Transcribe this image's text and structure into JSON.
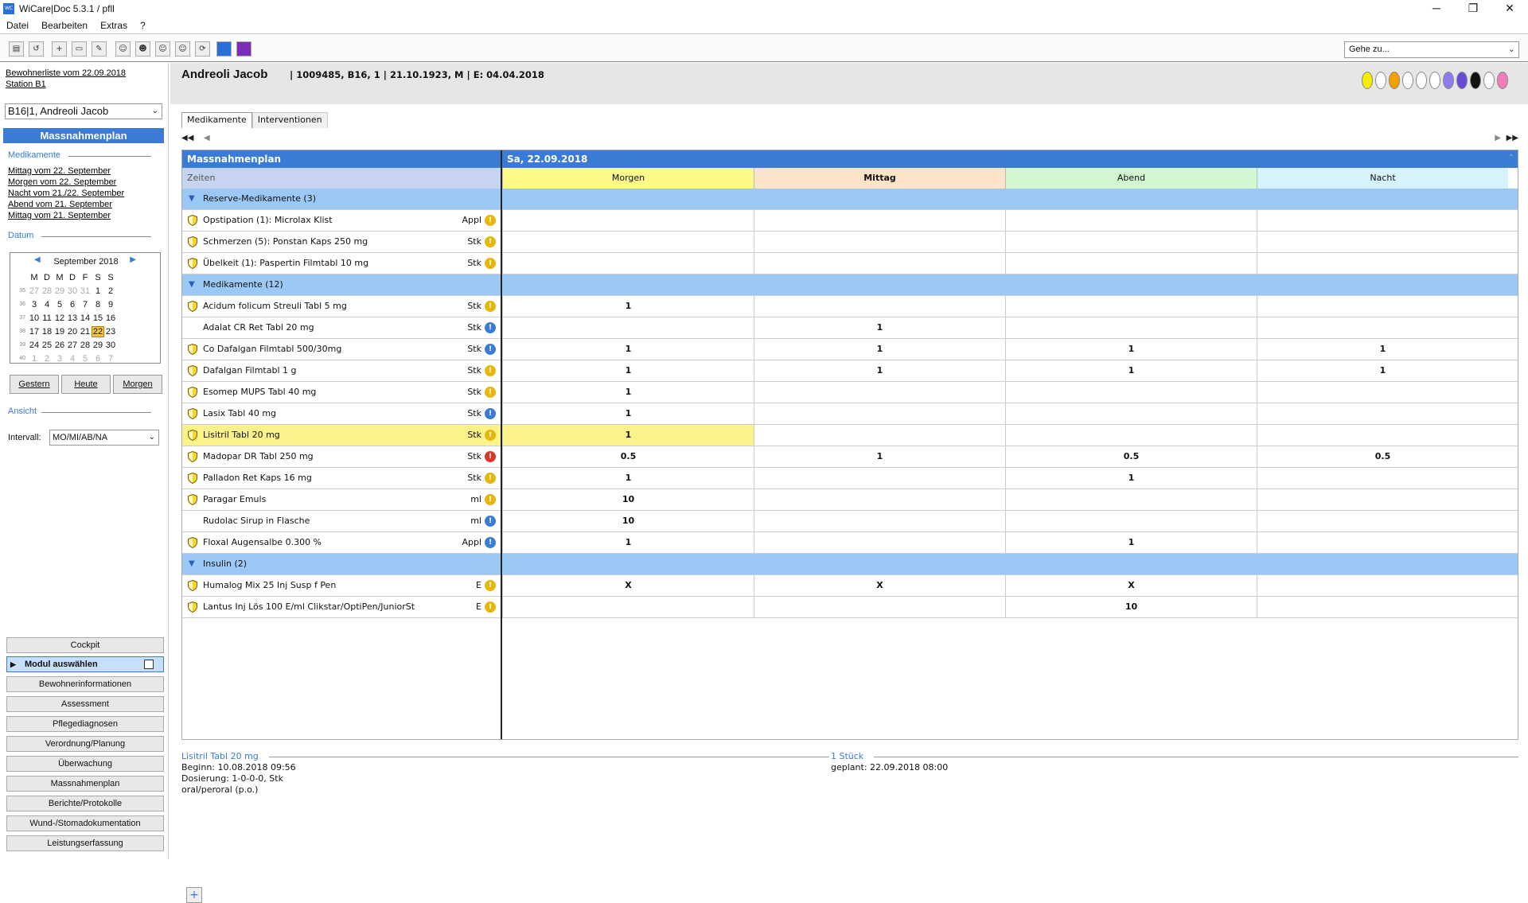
{
  "window": {
    "title": "WiCare|Doc 5.3.1  / pfll",
    "app_icon": "wicare-app-icon"
  },
  "menu": [
    "Datei",
    "Bearbeiten",
    "Extras",
    "?"
  ],
  "toolbar": {
    "goto_placeholder": "Gehe zu..."
  },
  "left": {
    "list_link": "Bewohnerliste vom 22.09.2018",
    "station_link": "Station B1",
    "resident_select": "B16|1, Andreoli Jacob",
    "massnahmenplan": "Massnahmenplan",
    "section_medikamente": "Medikamente",
    "med_links": [
      "Mittag vom 22. September",
      "Morgen vom 22. September",
      "Nacht vom 21./22. September",
      "Abend vom 21. September",
      "Mittag vom 21. September"
    ],
    "section_datum": "Datum",
    "calendar": {
      "month": "September 2018",
      "weekdays": [
        "M",
        "D",
        "M",
        "D",
        "F",
        "S",
        "S"
      ],
      "weeks": [
        {
          "wk": "35",
          "days": [
            [
              "27",
              true
            ],
            [
              "28",
              true
            ],
            [
              "29",
              true
            ],
            [
              "30",
              true
            ],
            [
              "31",
              true
            ],
            [
              "1",
              false
            ],
            [
              "2",
              false
            ]
          ]
        },
        {
          "wk": "36",
          "days": [
            [
              "3",
              false
            ],
            [
              "4",
              false
            ],
            [
              "5",
              false
            ],
            [
              "6",
              false
            ],
            [
              "7",
              false
            ],
            [
              "8",
              false
            ],
            [
              "9",
              false
            ]
          ]
        },
        {
          "wk": "37",
          "days": [
            [
              "10",
              false
            ],
            [
              "11",
              false
            ],
            [
              "12",
              false
            ],
            [
              "13",
              false
            ],
            [
              "14",
              false
            ],
            [
              "15",
              false
            ],
            [
              "16",
              false
            ]
          ]
        },
        {
          "wk": "38",
          "days": [
            [
              "17",
              false
            ],
            [
              "18",
              false
            ],
            [
              "19",
              false
            ],
            [
              "20",
              false
            ],
            [
              "21",
              false
            ],
            [
              "22",
              false
            ],
            [
              "23",
              false
            ]
          ]
        },
        {
          "wk": "39",
          "days": [
            [
              "24",
              false
            ],
            [
              "25",
              false
            ],
            [
              "26",
              false
            ],
            [
              "27",
              false
            ],
            [
              "28",
              false
            ],
            [
              "29",
              false
            ],
            [
              "30",
              false
            ]
          ]
        },
        {
          "wk": "40",
          "days": [
            [
              "1",
              true
            ],
            [
              "2",
              true
            ],
            [
              "3",
              true
            ],
            [
              "4",
              true
            ],
            [
              "5",
              true
            ],
            [
              "6",
              true
            ],
            [
              "7",
              true
            ]
          ]
        }
      ],
      "selected": "22"
    },
    "btn_gestern": "Gestern",
    "btn_heute": "Heute",
    "btn_morgen": "Morgen",
    "section_ansicht": "Ansicht",
    "interval_label": "Intervall:",
    "interval_value": "MO/MI/AB/NA",
    "modules": [
      "Cockpit",
      "Modul auswählen",
      "Bewohnerinformationen",
      "Assessment",
      "Pflegediagnosen",
      "Verordnung/Planung",
      "Überwachung",
      "Massnahmenplan",
      "Berichte/Protokolle",
      "Wund-/Stomadokumentation",
      "Leistungserfassung"
    ]
  },
  "patient": {
    "name": "Andreoli Jacob",
    "info": "| 1009485, B16, 1 | 21.10.1923, M | E: 04.04.2018",
    "color_dots": [
      "#f6ec00",
      "#ffffff",
      "#f5a000",
      "#ffffff",
      "#ffffff",
      "#ffffff",
      "#8c7cf0",
      "#6a4bd8",
      "#111111",
      "#ffffff",
      "#f07cb8"
    ]
  },
  "tabs": [
    "Medikamente",
    "Interventionen"
  ],
  "grid": {
    "left_header": "Massnahmenplan",
    "date_header": "Sa, 22.09.2018",
    "zeiten": "Zeiten",
    "columns": [
      {
        "label": "Morgen",
        "color": "#fdfa8a"
      },
      {
        "label": "Mittag",
        "color": "#fde3c8"
      },
      {
        "label": "Abend",
        "color": "#d3f7d0"
      },
      {
        "label": "Nacht",
        "color": "#d6f3fb"
      }
    ],
    "rows": [
      {
        "group": "Reserve-Medikamente (3)"
      },
      {
        "shield": true,
        "name": "Opstipation (1): Microlax Klist",
        "unit": "Appl",
        "info": "y",
        "vals": [
          "",
          "",
          "",
          ""
        ]
      },
      {
        "shield": true,
        "name": "Schmerzen (5): Ponstan Kaps 250 mg",
        "unit": "Stk",
        "info": "y",
        "vals": [
          "",
          "",
          "",
          ""
        ]
      },
      {
        "shield": true,
        "name": "Übelkeit (1): Paspertin Filmtabl 10 mg",
        "unit": "Stk",
        "info": "y",
        "vals": [
          "",
          "",
          "",
          ""
        ]
      },
      {
        "group": "Medikamente (12)"
      },
      {
        "shield": true,
        "name": "Acidum folicum Streuli Tabl 5 mg",
        "unit": "Stk",
        "info": "y",
        "vals": [
          "1",
          "",
          "",
          ""
        ]
      },
      {
        "shield": false,
        "name": "Adalat CR Ret Tabl 20 mg",
        "unit": "Stk",
        "info": "b",
        "vals": [
          "",
          "1",
          "",
          ""
        ]
      },
      {
        "shield": true,
        "name": "Co Dafalgan Filmtabl 500/30mg",
        "unit": "Stk",
        "info": "b",
        "vals": [
          "1",
          "1",
          "1",
          "1"
        ]
      },
      {
        "shield": true,
        "name": "Dafalgan Filmtabl 1 g",
        "unit": "Stk",
        "info": "y",
        "vals": [
          "1",
          "1",
          "1",
          "1"
        ]
      },
      {
        "shield": true,
        "name": "Esomep MUPS Tabl 40 mg",
        "unit": "Stk",
        "info": "y",
        "vals": [
          "1",
          "",
          "",
          ""
        ]
      },
      {
        "shield": true,
        "name": "Lasix Tabl 40 mg",
        "unit": "Stk",
        "info": "b",
        "vals": [
          "1",
          "",
          "",
          ""
        ]
      },
      {
        "shield": true,
        "name": "Lisitril Tabl 20 mg",
        "unit": "Stk",
        "info": "y",
        "vals": [
          "1",
          "",
          "",
          ""
        ],
        "highlight": true
      },
      {
        "shield": true,
        "name": "Madopar DR Tabl 250 mg",
        "unit": "Stk",
        "info": "r",
        "vals": [
          "0.5",
          "1",
          "0.5",
          "0.5"
        ]
      },
      {
        "shield": true,
        "name": "Palladon Ret Kaps 16 mg",
        "unit": "Stk",
        "info": "y",
        "vals": [
          "1",
          "",
          "1",
          ""
        ]
      },
      {
        "shield": true,
        "name": "Paragar Emuls",
        "unit": "ml",
        "info": "y",
        "vals": [
          "10",
          "",
          "",
          ""
        ]
      },
      {
        "shield": false,
        "name": "Rudolac Sirup in Flasche",
        "unit": "ml",
        "info": "b",
        "vals": [
          "10",
          "",
          "",
          ""
        ]
      },
      {
        "shield": true,
        "name": "Floxal Augensalbe 0.300 %",
        "unit": "Appl",
        "info": "b",
        "vals": [
          "1",
          "",
          "1",
          ""
        ]
      },
      {
        "group": "Insulin (2)"
      },
      {
        "shield": true,
        "name": "Humalog Mix 25 Inj Susp f Pen",
        "unit": "E",
        "info": "y",
        "vals": [
          "X",
          "X",
          "X",
          ""
        ]
      },
      {
        "shield": true,
        "name": "Lantus Inj Lös 100 E/ml Clikstar/OptiPen/JuniorSt",
        "unit": "E",
        "info": "y",
        "vals": [
          "",
          "",
          "10",
          ""
        ]
      }
    ]
  },
  "details": {
    "left_title": "Lisitril Tabl 20 mg",
    "left_lines": [
      "Beginn: 10.08.2018 09:56",
      "Dosierung: 1-0-0-0, Stk",
      "oral/peroral (p.o.)"
    ],
    "right_title": "1 Stück",
    "right_lines": [
      "geplant: 22.09.2018 08:00"
    ]
  },
  "add_label": "+"
}
